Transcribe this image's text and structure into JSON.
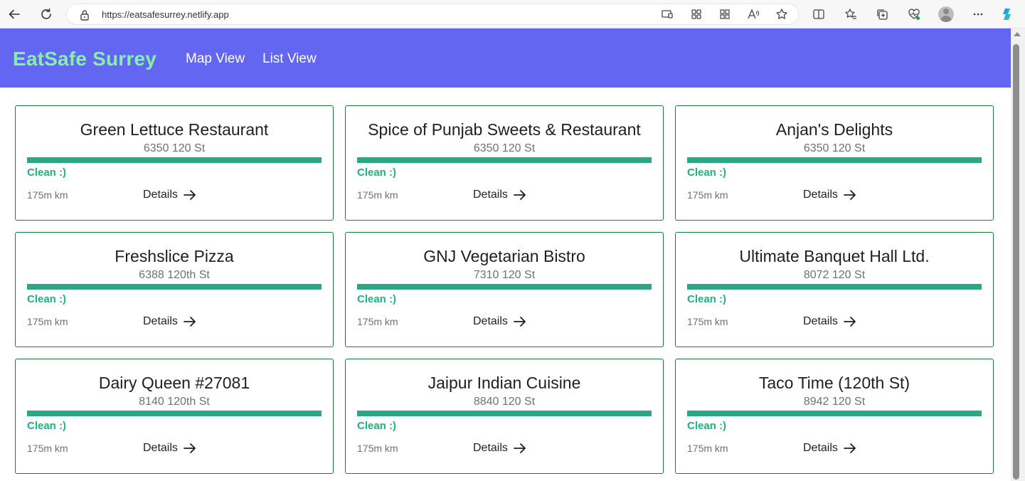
{
  "browser": {
    "url": "https://eatsafesurrey.netlify.app"
  },
  "app": {
    "brand": "EatSafe Surrey",
    "nav": [
      {
        "label": "Map View"
      },
      {
        "label": "List View"
      }
    ],
    "colors": {
      "header": "#6366f1",
      "brand": "#86efac",
      "status_bar": "#2aa784",
      "status_text": "#22b07d",
      "card_border": "#15803d"
    }
  },
  "restaurants": [
    {
      "name": "Green Lettuce Restaurant",
      "address": "6350 120 St",
      "status": "Clean :)",
      "distance": "175m km",
      "details_label": "Details"
    },
    {
      "name": "Spice of Punjab Sweets & Restaurant",
      "address": "6350 120 St",
      "status": "Clean :)",
      "distance": "175m km",
      "details_label": "Details"
    },
    {
      "name": "Anjan's Delights",
      "address": "6350 120 St",
      "status": "Clean :)",
      "distance": "175m km",
      "details_label": "Details"
    },
    {
      "name": "Freshslice Pizza",
      "address": "6388 120th St",
      "status": "Clean :)",
      "distance": "175m km",
      "details_label": "Details"
    },
    {
      "name": "GNJ Vegetarian Bistro",
      "address": "7310 120 St",
      "status": "Clean :)",
      "distance": "175m km",
      "details_label": "Details"
    },
    {
      "name": "Ultimate Banquet Hall Ltd.",
      "address": "8072 120 St",
      "status": "Clean :)",
      "distance": "175m km",
      "details_label": "Details"
    },
    {
      "name": "Dairy Queen #27081",
      "address": "8140 120th St",
      "status": "Clean :)",
      "distance": "175m km",
      "details_label": "Details"
    },
    {
      "name": "Jaipur Indian Cuisine",
      "address": "8840 120 St",
      "status": "Clean :)",
      "distance": "175m km",
      "details_label": "Details"
    },
    {
      "name": "Taco Time (120th St)",
      "address": "8942 120 St",
      "status": "Clean :)",
      "distance": "175m km",
      "details_label": "Details"
    }
  ]
}
